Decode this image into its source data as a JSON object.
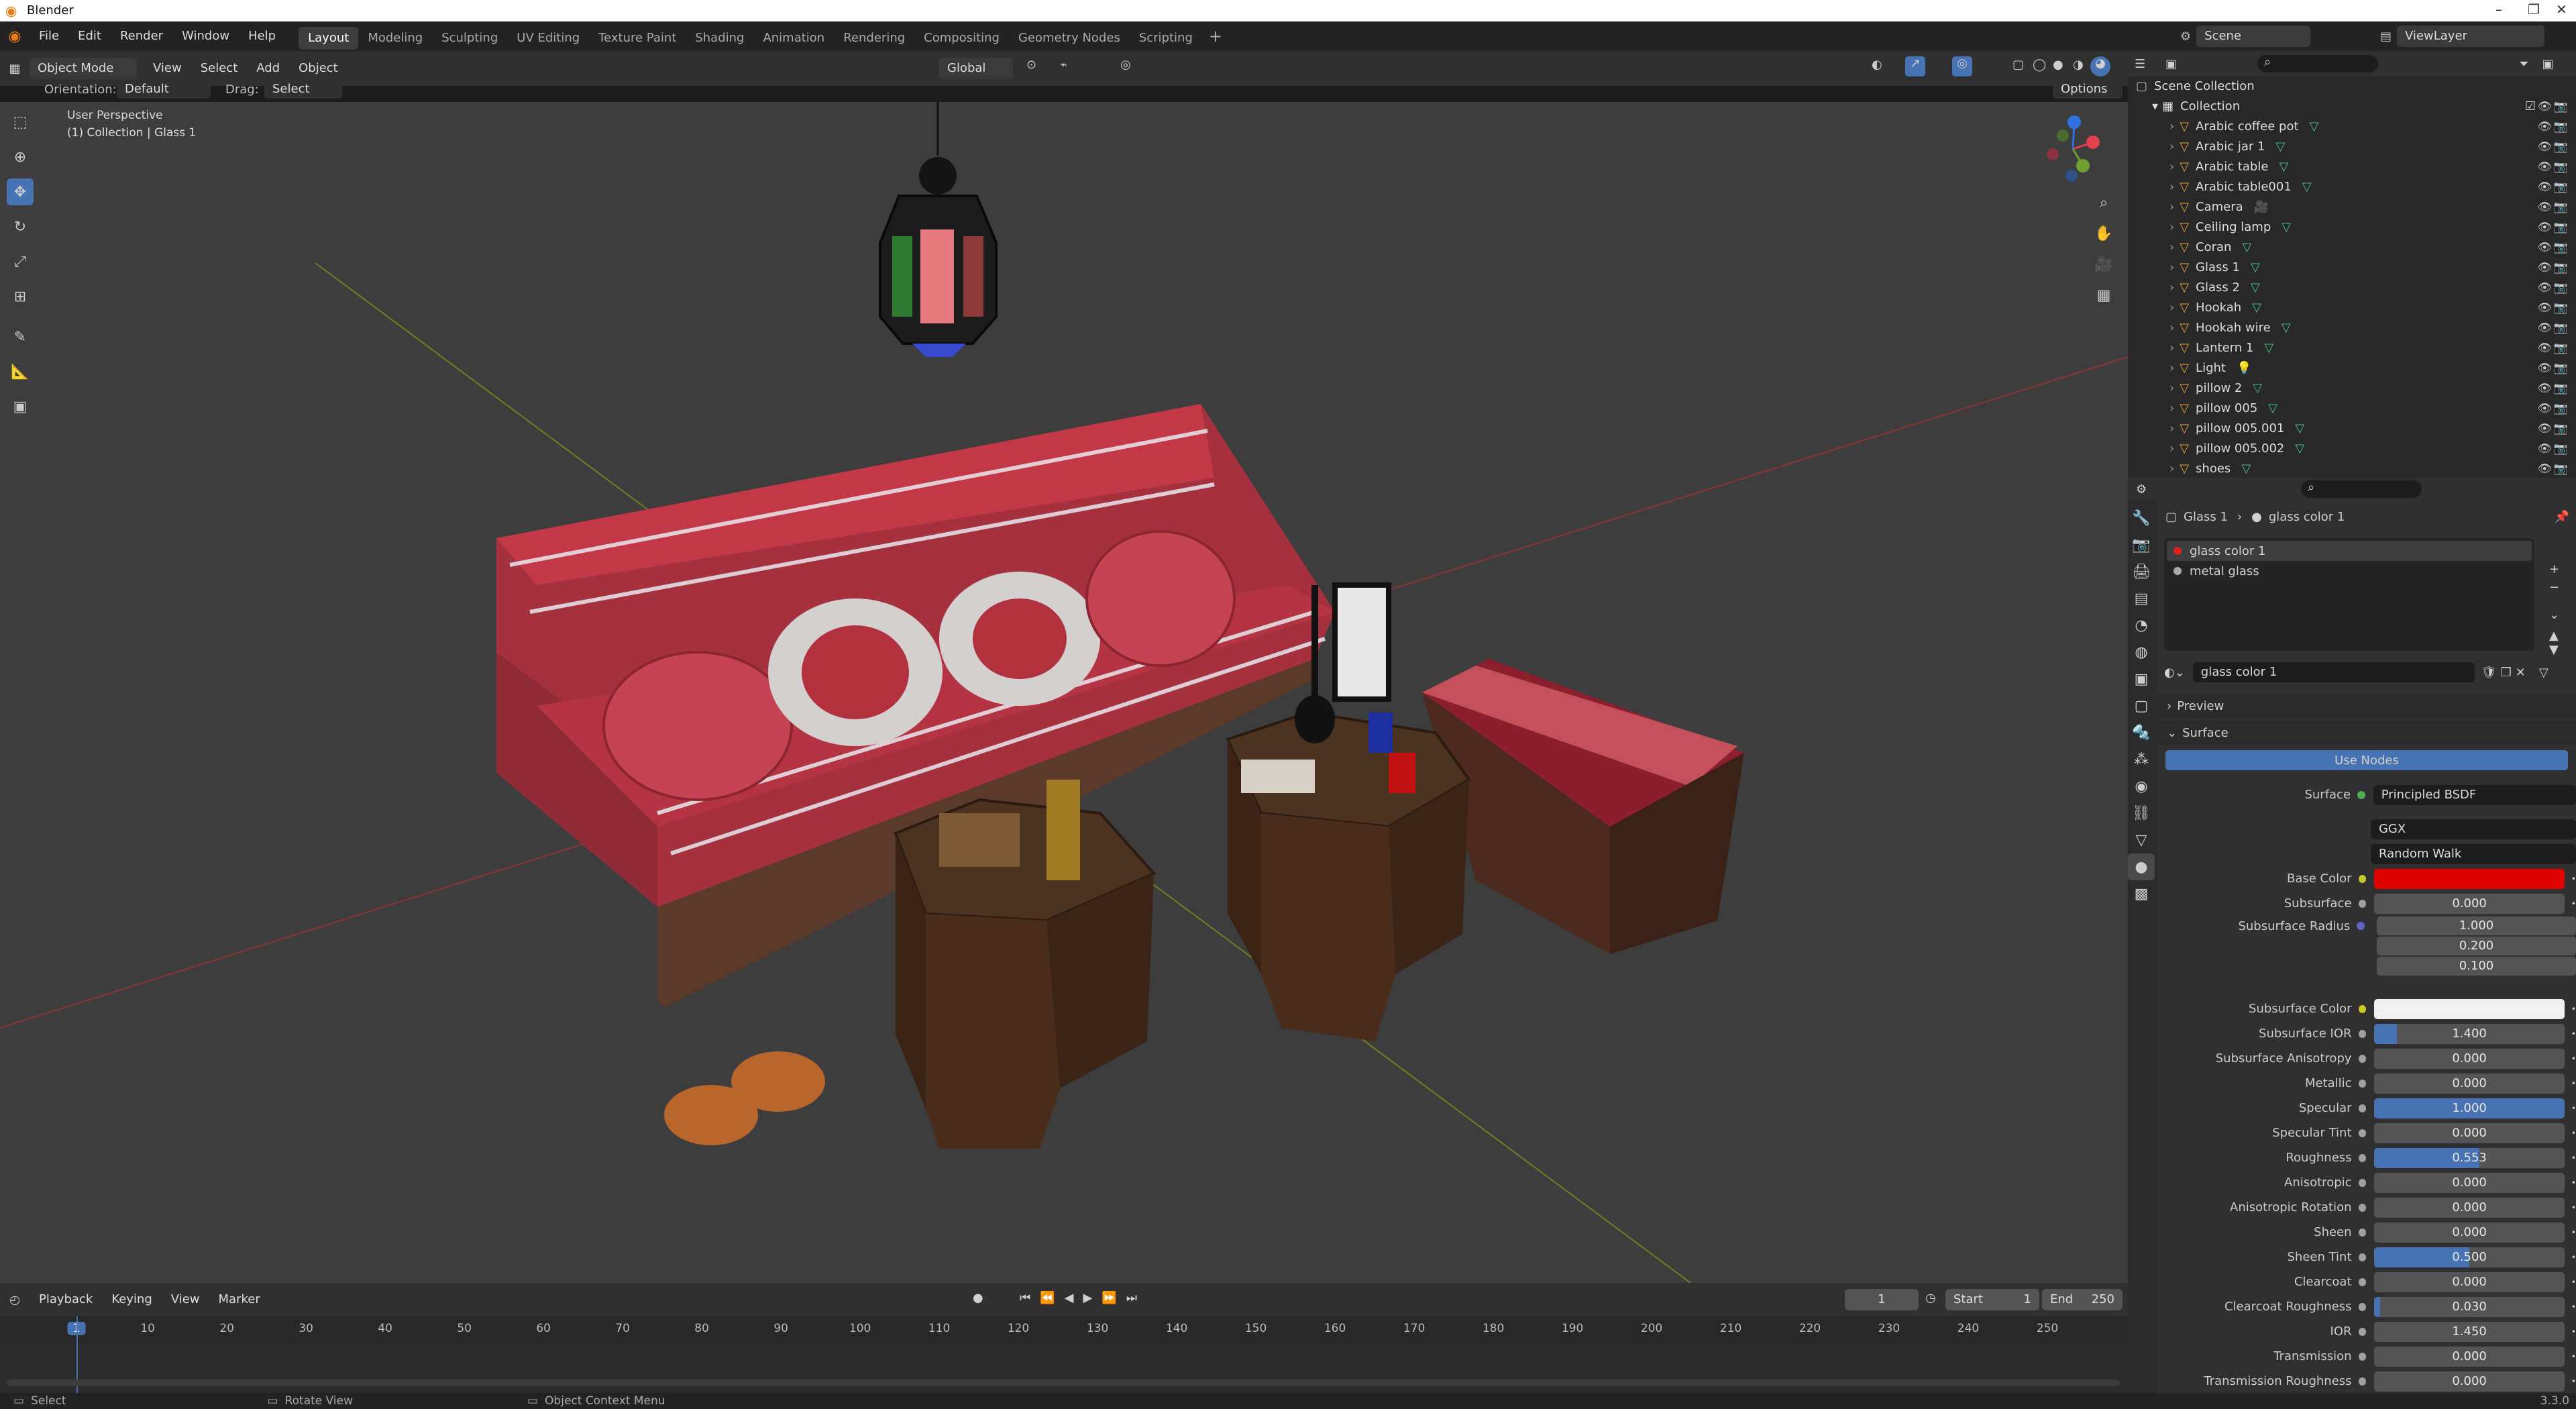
{
  "app": {
    "title": "Blender"
  },
  "menu": [
    "File",
    "Edit",
    "Render",
    "Window",
    "Help"
  ],
  "workspaces": [
    "Layout",
    "Modeling",
    "Sculpting",
    "UV Editing",
    "Texture Paint",
    "Shading",
    "Animation",
    "Rendering",
    "Compositing",
    "Geometry Nodes",
    "Scripting"
  ],
  "active_workspace": "Layout",
  "scene": {
    "name": "Scene",
    "view_layer": "ViewLayer"
  },
  "viewport_header": {
    "mode": "Object Mode",
    "menus": [
      "View",
      "Select",
      "Add",
      "Object"
    ],
    "transform": "Global",
    "orientation_label": "Orientation:",
    "orientation_value": "Default",
    "drag_label": "Drag:",
    "drag_value": "Select Box",
    "options": "Options"
  },
  "viewport": {
    "perspective": "User Perspective",
    "context": "(1) Collection | Glass 1"
  },
  "outliner": {
    "root": "Scene Collection",
    "collection": "Collection",
    "items": [
      {
        "name": "Arabic coffee pot",
        "icon": "mesh"
      },
      {
        "name": "Arabic jar 1",
        "icon": "mesh"
      },
      {
        "name": "Arabic table",
        "icon": "mesh"
      },
      {
        "name": "Arabic table001",
        "icon": "mesh"
      },
      {
        "name": "Camera",
        "icon": "camera"
      },
      {
        "name": "Ceiling lamp",
        "icon": "mesh"
      },
      {
        "name": "Coran",
        "icon": "mesh"
      },
      {
        "name": "Glass 1",
        "icon": "mesh"
      },
      {
        "name": "Glass 2",
        "icon": "mesh"
      },
      {
        "name": "Hookah",
        "icon": "mesh"
      },
      {
        "name": "Hookah wire",
        "icon": "mesh"
      },
      {
        "name": "Lantern 1",
        "icon": "mesh"
      },
      {
        "name": "Light",
        "icon": "light"
      },
      {
        "name": "pillow 2",
        "icon": "mesh"
      },
      {
        "name": "pillow 005",
        "icon": "mesh"
      },
      {
        "name": "pillow 005.001",
        "icon": "mesh"
      },
      {
        "name": "pillow 005.002",
        "icon": "mesh"
      },
      {
        "name": "shoes",
        "icon": "mesh"
      }
    ]
  },
  "properties": {
    "breadcrumb_object": "Glass 1",
    "breadcrumb_material": "glass color 1",
    "material_slots": [
      "glass color 1",
      "metal glass"
    ],
    "material_name": "glass color 1",
    "sections": {
      "preview": "Preview",
      "surface": "Surface"
    },
    "use_nodes": "Use Nodes",
    "surface_label": "Surface",
    "surface_value": "Principled BSDF",
    "distribution": "GGX",
    "subsurface_method": "Random Walk",
    "rows": [
      {
        "label": "Base Color",
        "type": "color",
        "value": "",
        "color": "#e00000"
      },
      {
        "label": "Subsurface",
        "type": "num",
        "value": "0.000",
        "fill": 0
      },
      {
        "label": "Subsurface Radius",
        "type": "vec",
        "values": [
          "1.000",
          "0.200",
          "0.100"
        ]
      },
      {
        "label": "Subsurface Color",
        "type": "color",
        "value": "",
        "color": "#f0f0f0"
      },
      {
        "label": "Subsurface IOR",
        "type": "num",
        "value": "1.400",
        "fill": 0.12
      },
      {
        "label": "Subsurface Anisotropy",
        "type": "num",
        "value": "0.000",
        "fill": 0
      },
      {
        "label": "Metallic",
        "type": "num",
        "value": "0.000",
        "fill": 0
      },
      {
        "label": "Specular",
        "type": "num",
        "value": "1.000",
        "fill": 1
      },
      {
        "label": "Specular Tint",
        "type": "num",
        "value": "0.000",
        "fill": 0
      },
      {
        "label": "Roughness",
        "type": "num",
        "value": "0.553",
        "fill": 0.553
      },
      {
        "label": "Anisotropic",
        "type": "num",
        "value": "0.000",
        "fill": 0
      },
      {
        "label": "Anisotropic Rotation",
        "type": "num",
        "value": "0.000",
        "fill": 0
      },
      {
        "label": "Sheen",
        "type": "num",
        "value": "0.000",
        "fill": 0
      },
      {
        "label": "Sheen Tint",
        "type": "num",
        "value": "0.500",
        "fill": 0.5
      },
      {
        "label": "Clearcoat",
        "type": "num",
        "value": "0.000",
        "fill": 0
      },
      {
        "label": "Clearcoat Roughness",
        "type": "num",
        "value": "0.030",
        "fill": 0.03
      },
      {
        "label": "IOR",
        "type": "num",
        "value": "1.450",
        "fill": 0
      },
      {
        "label": "Transmission",
        "type": "num",
        "value": "0.000",
        "fill": 0
      },
      {
        "label": "Transmission Roughness",
        "type": "num",
        "value": "0.000",
        "fill": 0
      }
    ]
  },
  "timeline": {
    "menus": [
      "Playback",
      "Keying",
      "View",
      "Marker"
    ],
    "current_frame": "1",
    "start_label": "Start",
    "start": "1",
    "end_label": "End",
    "end": "250",
    "ticks": [
      "1",
      "10",
      "20",
      "30",
      "40",
      "50",
      "60",
      "70",
      "80",
      "90",
      "100",
      "110",
      "120",
      "130",
      "140",
      "150",
      "160",
      "170",
      "180",
      "190",
      "200",
      "210",
      "220",
      "230",
      "240",
      "250"
    ]
  },
  "statusbar": {
    "select": "Select",
    "rotate": "Rotate View",
    "context": "Object Context Menu",
    "version": "3.3.0"
  }
}
